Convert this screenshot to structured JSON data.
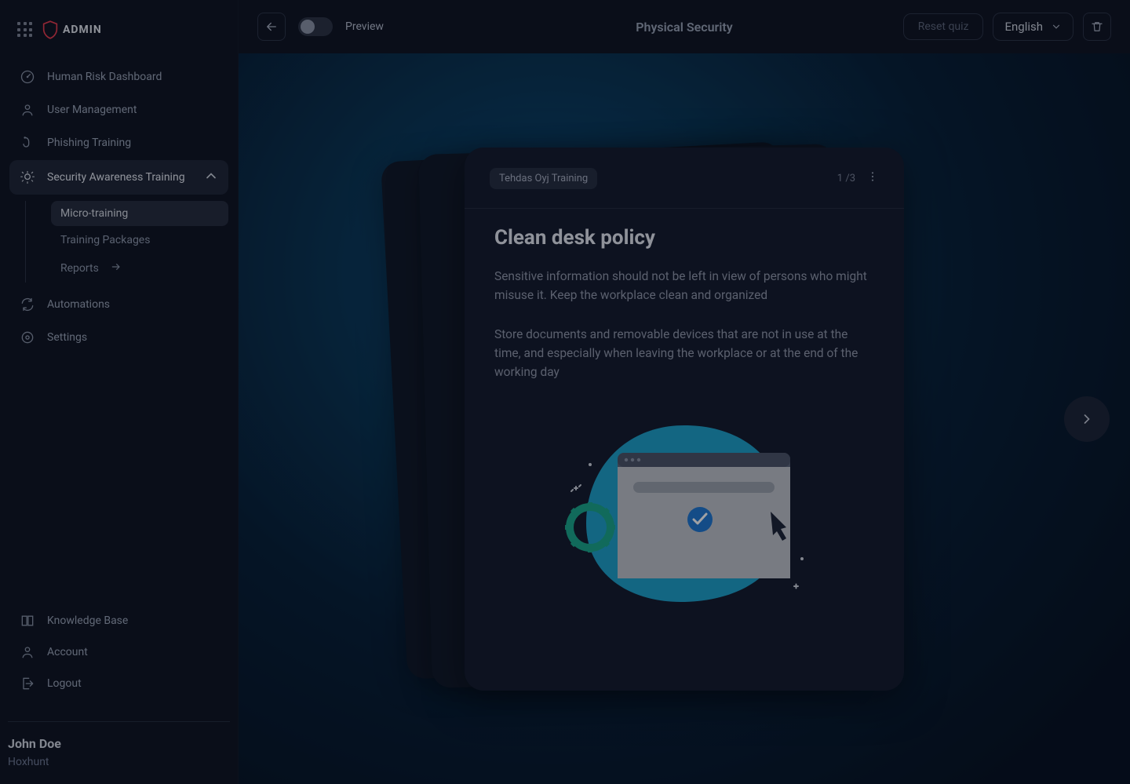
{
  "brand": {
    "label": "ADMIN"
  },
  "sidebar": {
    "items": [
      {
        "label": "Human Risk Dashboard"
      },
      {
        "label": "User Management"
      },
      {
        "label": "Phishing Training"
      },
      {
        "label": "Security Awareness Training"
      },
      {
        "label": "Automations"
      },
      {
        "label": "Settings"
      }
    ],
    "sub": [
      {
        "label": "Micro-training"
      },
      {
        "label": "Training Packages"
      },
      {
        "label": "Reports"
      }
    ],
    "bottom": [
      {
        "label": "Knowledge Base"
      },
      {
        "label": "Account"
      },
      {
        "label": "Logout"
      }
    ],
    "user": {
      "name": "John Doe",
      "org": "Hoxhunt"
    }
  },
  "topbar": {
    "preview": "Preview",
    "title": "Physical Security",
    "reset": "Reset quiz",
    "language": "English"
  },
  "card": {
    "tag": "Tehdas Oyj Training",
    "page": "1 /3",
    "title": "Clean desk policy",
    "para1": "Sensitive information should not be left in view of persons who might misuse it. Keep the workplace clean and organized",
    "para2": "Store documents and removable devices that are not in use at the time, and especially when leaving the workplace or at the end of the working day"
  }
}
